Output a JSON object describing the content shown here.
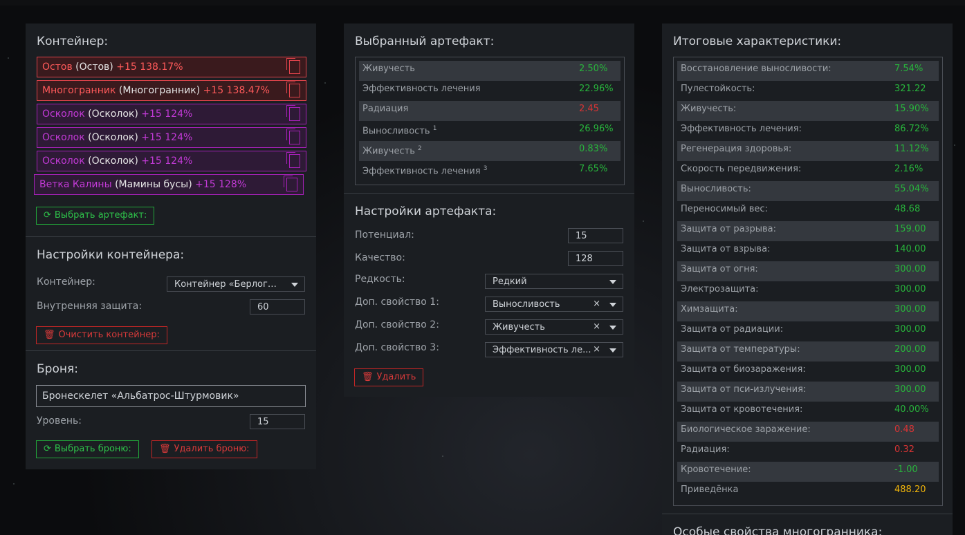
{
  "container": {
    "title": "Контейнер:",
    "items": [
      {
        "name": "Остов",
        "base": "(Остов)",
        "level": "+15 138.17%",
        "color": "red"
      },
      {
        "name": "Многогранник",
        "base": "(Многогранник)",
        "level": "+15 138.47%",
        "color": "red"
      },
      {
        "name": "Осколок",
        "base": "(Осколок)",
        "level": "+15 124%",
        "color": "purple"
      },
      {
        "name": "Осколок",
        "base": "(Осколок)",
        "level": "+15 124%",
        "color": "purple"
      },
      {
        "name": "Осколок",
        "base": "(Осколок)",
        "level": "+15 124%",
        "color": "purple"
      },
      {
        "name": "Ветка Калины",
        "base": "(Мамины бусы)",
        "level": "+15 128%",
        "color": "purple"
      }
    ],
    "select_artifact_label": "Выбрать артефакт:"
  },
  "container_settings": {
    "title": "Настройки контейнера:",
    "container_label": "Контейнер:",
    "container_value": "Контейнер «Берлога...",
    "inner_protection_label": "Внутренняя защита:",
    "inner_protection_value": "60",
    "clear_label": "Очистить контейнер:"
  },
  "armor": {
    "title": "Броня:",
    "name_value": "Бронескелет «Альбатрос-Штурмовик»",
    "level_label": "Уровень:",
    "level_value": "15",
    "select_label": "Выбрать броню:",
    "delete_label": "Удалить броню:"
  },
  "selected_artifact": {
    "title": "Выбранный артефакт:",
    "stats": [
      {
        "name": "Живучесть",
        "sup": "",
        "value": "2.50%",
        "tone": "g"
      },
      {
        "name": "Эффективность лечения",
        "sup": "",
        "value": "22.96%",
        "tone": "g"
      },
      {
        "name": "Радиация",
        "sup": "",
        "value": "2.45",
        "tone": "r"
      },
      {
        "name": "Выносливость",
        "sup": "1",
        "value": "26.96%",
        "tone": "g"
      },
      {
        "name": "Живучесть",
        "sup": "2",
        "value": "0.83%",
        "tone": "g"
      },
      {
        "name": "Эффективность лечения",
        "sup": "3",
        "value": "7.65%",
        "tone": "g"
      }
    ]
  },
  "artifact_settings": {
    "title": "Настройки артефакта:",
    "potential_label": "Потенциал:",
    "potential_value": "15",
    "quality_label": "Качество:",
    "quality_value": "128",
    "rarity_label": "Редкость:",
    "rarity_value": "Редкий",
    "extra1_label": "Доп. свойство 1:",
    "extra1_value": "Выносливость",
    "extra2_label": "Доп. свойство 2:",
    "extra2_value": "Живучесть",
    "extra3_label": "Доп. свойство 3:",
    "extra3_value": "Эффективность ле...",
    "clear_mark": "×",
    "delete_label": "Удалить"
  },
  "totals": {
    "title": "Итоговые характеристики:",
    "stats": [
      {
        "name": "Восстановление выносливости:",
        "value": "7.54%",
        "tone": "g"
      },
      {
        "name": "Пулестойкость:",
        "value": "321.22",
        "tone": "g"
      },
      {
        "name": "Живучесть:",
        "value": "15.90%",
        "tone": "g"
      },
      {
        "name": "Эффективность лечения:",
        "value": "86.72%",
        "tone": "g"
      },
      {
        "name": "Регенерация здоровья:",
        "value": "11.12%",
        "tone": "g"
      },
      {
        "name": "Скорость передвижения:",
        "value": "2.16%",
        "tone": "g"
      },
      {
        "name": "Выносливость:",
        "value": "55.04%",
        "tone": "g"
      },
      {
        "name": "Переносимый вес:",
        "value": "48.68",
        "tone": "g"
      },
      {
        "name": "Защита от разрыва:",
        "value": "159.00",
        "tone": "g"
      },
      {
        "name": "Защита от взрыва:",
        "value": "140.00",
        "tone": "g"
      },
      {
        "name": "Защита от огня:",
        "value": "300.00",
        "tone": "g"
      },
      {
        "name": "Электрозащита:",
        "value": "300.00",
        "tone": "g"
      },
      {
        "name": "Химзащита:",
        "value": "300.00",
        "tone": "g"
      },
      {
        "name": "Защита от радиации:",
        "value": "300.00",
        "tone": "g"
      },
      {
        "name": "Защита от температуры:",
        "value": "200.00",
        "tone": "g"
      },
      {
        "name": "Защита от биозаражения:",
        "value": "300.00",
        "tone": "g"
      },
      {
        "name": "Защита от пси-излучения:",
        "value": "300.00",
        "tone": "g"
      },
      {
        "name": "Защита от кровотечения:",
        "value": "40.00%",
        "tone": "g"
      },
      {
        "name": "Биологическое заражение:",
        "value": "0.48",
        "tone": "r"
      },
      {
        "name": "Радиация:",
        "value": "0.32",
        "tone": "r"
      },
      {
        "name": "Кровотечение:",
        "value": "-1.00",
        "tone": "g"
      },
      {
        "name": "Приведёнка",
        "value": "488.20",
        "tone": "y"
      }
    ]
  },
  "special": {
    "title": "Особые свойства многогранника:"
  },
  "icons": {
    "copy": "copy-icon",
    "refresh": "refresh-icon",
    "trash": "trash-icon",
    "chevron": "chevron-down-icon"
  }
}
